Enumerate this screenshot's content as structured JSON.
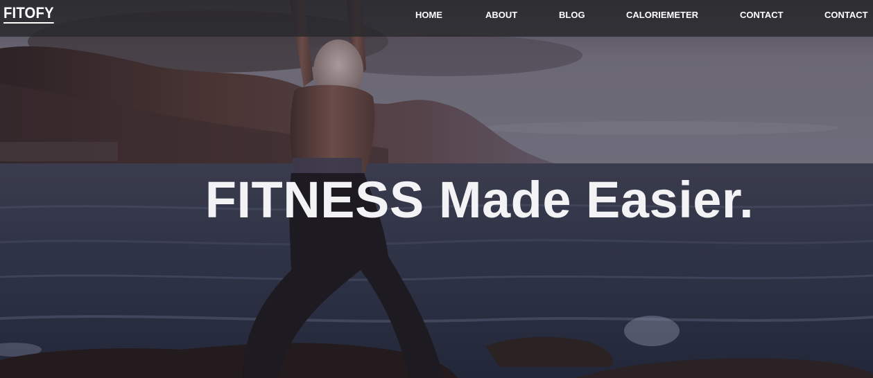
{
  "brand": {
    "name": "FITOFY"
  },
  "nav": {
    "items": [
      {
        "label": "HOME"
      },
      {
        "label": "ABOUT"
      },
      {
        "label": "BLOG"
      },
      {
        "label": "CALORIEMETER"
      },
      {
        "label": "CONTACT"
      },
      {
        "label": "CONTACT"
      }
    ]
  },
  "hero": {
    "headline": "FITNESS Made Easier."
  },
  "colors": {
    "nav_background": "#2b2b2f",
    "text": "#ffffff",
    "headline": "#f3f3f5",
    "sky": "#6e6b78",
    "sea": "#2f3447"
  }
}
